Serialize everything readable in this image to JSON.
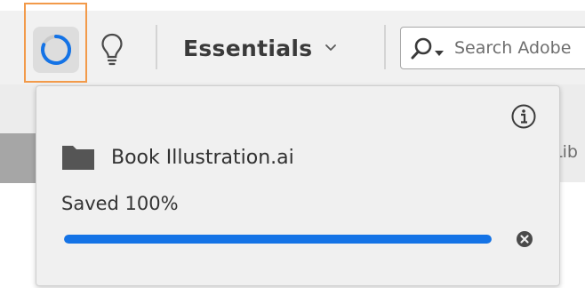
{
  "toolbar": {
    "workspace_label": "Essentials",
    "search_placeholder": "Search Adobe"
  },
  "panel": {
    "libraries_tab_label": "Lib"
  },
  "sync_popover": {
    "file_name": "Book Illustration.ai",
    "status_text": "Saved 100%",
    "progress": 1.0
  },
  "colors": {
    "accent_blue": "#1473e6",
    "highlight_orange": "#f29a4a"
  },
  "icons": {
    "sync": "cloud-sync-progress-icon",
    "bulb": "lightbulb-icon",
    "chevron": "chevron-down-icon",
    "search": "search-icon",
    "info": "info-icon",
    "folder": "folder-icon",
    "cancel": "cancel-icon"
  }
}
